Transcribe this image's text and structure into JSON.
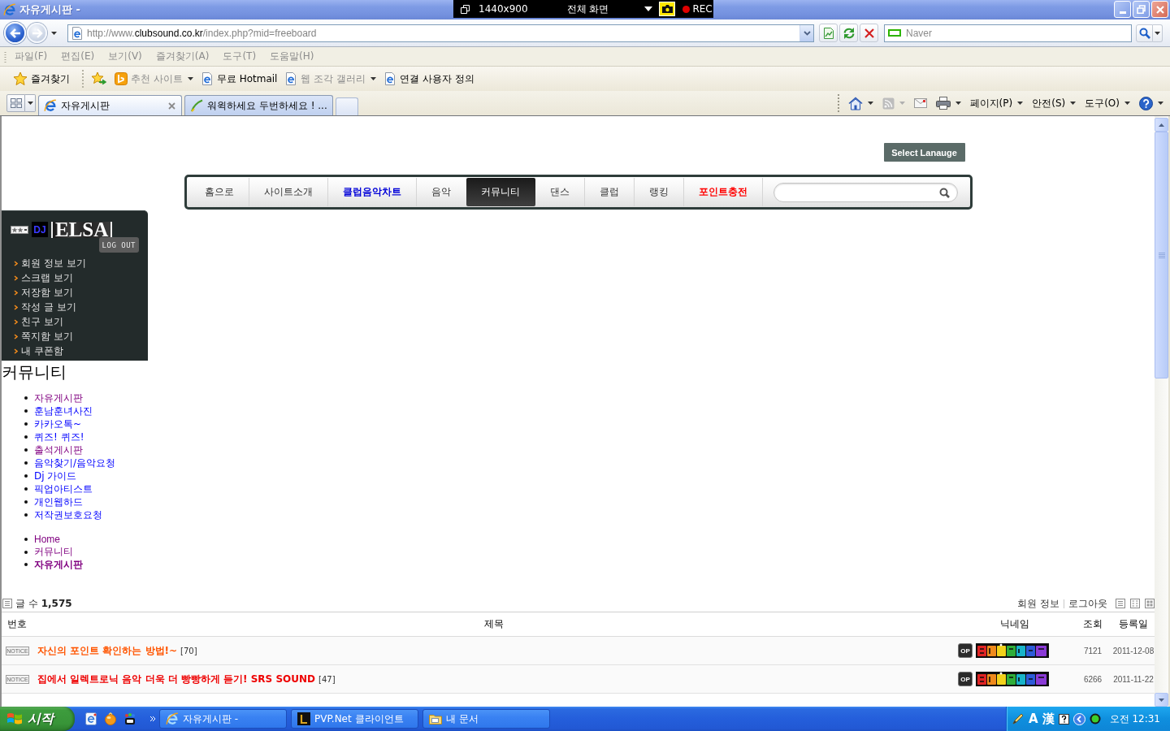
{
  "window": {
    "title": "자유게시판 -"
  },
  "recorder": {
    "resolution": "1440x900",
    "mode": "전체 화면",
    "status": "REC"
  },
  "address_bar": {
    "url": {
      "prefix": "http://www.",
      "domain": "clubsound.co.kr",
      "path": "/index.php?mid=freeboard"
    },
    "search_placeholder": "Naver"
  },
  "menu_bar": {
    "items": [
      "파일(F)",
      "편집(E)",
      "보기(V)",
      "즐겨찾기(A)",
      "도구(T)",
      "도움말(H)"
    ]
  },
  "favorites_bar": {
    "favorites_button": "즐겨찾기",
    "links": [
      {
        "kind": "suggested",
        "label": "추천 사이트",
        "disabled": true,
        "dropdown": true
      },
      {
        "kind": "page",
        "label": "무료 Hotmail",
        "disabled": false,
        "dropdown": false
      },
      {
        "kind": "page",
        "label": "웹 조각 갤러리",
        "disabled": true,
        "dropdown": true
      },
      {
        "kind": "page",
        "label": "연결 사용자 정의",
        "disabled": false,
        "dropdown": false
      }
    ]
  },
  "tabs": [
    {
      "kind": "ie",
      "label": "자유게시판",
      "selected": true
    },
    {
      "kind": "site",
      "label": "워윅하세요 두번하세요 ! ...",
      "selected": false
    }
  ],
  "command_bar": {
    "menus": [
      "페이지(P)",
      "안전(S)",
      "도구(O)"
    ]
  },
  "site_header": {
    "language_button": "Select Lanauge",
    "nav": [
      {
        "kind": "normal",
        "label": "홈으로",
        "selected": false
      },
      {
        "kind": "normal",
        "label": "사이트소개",
        "selected": false
      },
      {
        "kind": "chart",
        "label": "클럽음악차트",
        "selected": false
      },
      {
        "kind": "normal",
        "label": "음악",
        "selected": false
      },
      {
        "kind": "normal",
        "label": "커뮤니티",
        "selected": true
      },
      {
        "kind": "normal",
        "label": "댄스",
        "selected": false
      },
      {
        "kind": "normal",
        "label": "클럽",
        "selected": false
      },
      {
        "kind": "normal",
        "label": "랭킹",
        "selected": false
      },
      {
        "kind": "promo",
        "label": "포인트충전",
        "selected": false
      }
    ]
  },
  "member_panel": {
    "rank": "DJ",
    "nickname": "ELSA",
    "logout": "LOG OUT",
    "items": [
      "회원 정보 보기",
      "스크랩 보기",
      "저장함 보기",
      "작성 글 보기",
      "친구 보기",
      "쪽지함 보기",
      "내 쿠폰함"
    ]
  },
  "community": {
    "title": "커뮤니티",
    "links": [
      {
        "label": "자유게시판",
        "visited": true
      },
      {
        "label": "훈남훈녀사진",
        "visited": false
      },
      {
        "label": "카카오톡~",
        "visited": false
      },
      {
        "label": "퀴즈! 퀴즈!",
        "visited": false
      },
      {
        "label": "출석게시판",
        "visited": true
      },
      {
        "label": "음악찾기/음악요청",
        "visited": false
      },
      {
        "label": "Dj 가이드",
        "visited": false
      },
      {
        "label": "픽업아티스트",
        "visited": false
      },
      {
        "label": "개인웹하드",
        "visited": false
      },
      {
        "label": "저작권보호요청",
        "visited": false
      }
    ],
    "breadcrumb": [
      {
        "label": "Home",
        "current": false
      },
      {
        "label": "커뮤니티",
        "current": false
      },
      {
        "label": "자유게시판",
        "current": true
      }
    ]
  },
  "board": {
    "count": "글 수 **1,575**",
    "member_links": [
      "회원 정보",
      "로그아웃"
    ],
    "columns": [
      "번호",
      "제목",
      "닉네임",
      "조회",
      "등록일"
    ],
    "rows": [
      {
        "badge": "NOTICE",
        "title": "자신의 포인트 확인하는 방법!~",
        "comments": "[70]",
        "color": "#ff5500",
        "level_badge": "OP",
        "views": "7121",
        "date": "2011-12-08"
      },
      {
        "badge": "NOTICE",
        "title": "집에서 일렉트로닉 음악 더욱 더 빵빵하게 듣기! SRS SOUND",
        "comments": "[47]",
        "color": "#ee0000",
        "level_badge": "OP",
        "views": "6266",
        "date": "2011-11-22"
      }
    ]
  },
  "taskbar": {
    "start": "시작",
    "tasks": [
      {
        "kind": "ie",
        "label": "자유게시판 -"
      },
      {
        "kind": "app",
        "label": "PVP.Net 클라이언트"
      },
      {
        "kind": "folder",
        "label": "내 문서"
      }
    ],
    "ime": [
      "A",
      "漢"
    ],
    "clock": "오전 12:31"
  }
}
